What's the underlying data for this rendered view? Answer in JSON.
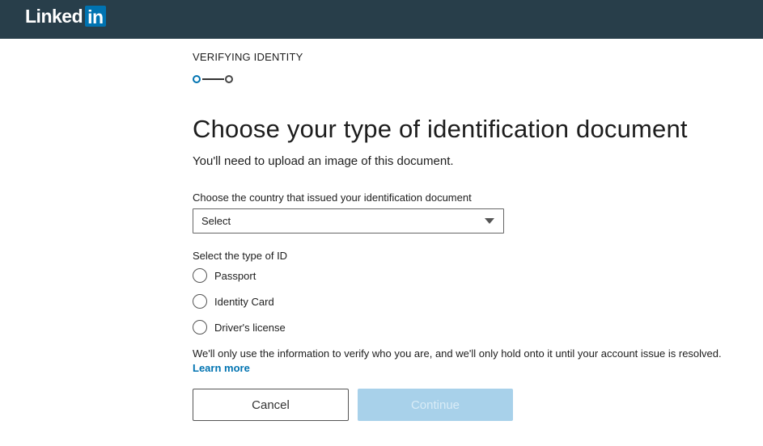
{
  "header": {
    "logo_text": "Linked",
    "logo_in": "in",
    "background_color": "#283e4a",
    "brand_color": "#0073b1"
  },
  "stepper": {
    "label": "VERIFYING IDENTITY",
    "current_step": 1,
    "total_steps": 2
  },
  "main": {
    "title": "Choose your type of identification document",
    "subtitle": "You'll need to upload an image of this document.",
    "country": {
      "label": "Choose the country that issued your identification document",
      "selected_value": "Select"
    },
    "id_type": {
      "label": "Select the type of ID",
      "options": [
        {
          "label": "Passport",
          "checked": false
        },
        {
          "label": "Identity Card",
          "checked": false
        },
        {
          "label": "Driver's license",
          "checked": false
        }
      ]
    },
    "notice": {
      "text": "We'll only use the information to verify who you are, and we'll only hold onto it until your account issue is resolved.",
      "link_text": "Learn more"
    },
    "buttons": {
      "cancel_label": "Cancel",
      "continue_label": "Continue",
      "continue_disabled": true
    }
  }
}
